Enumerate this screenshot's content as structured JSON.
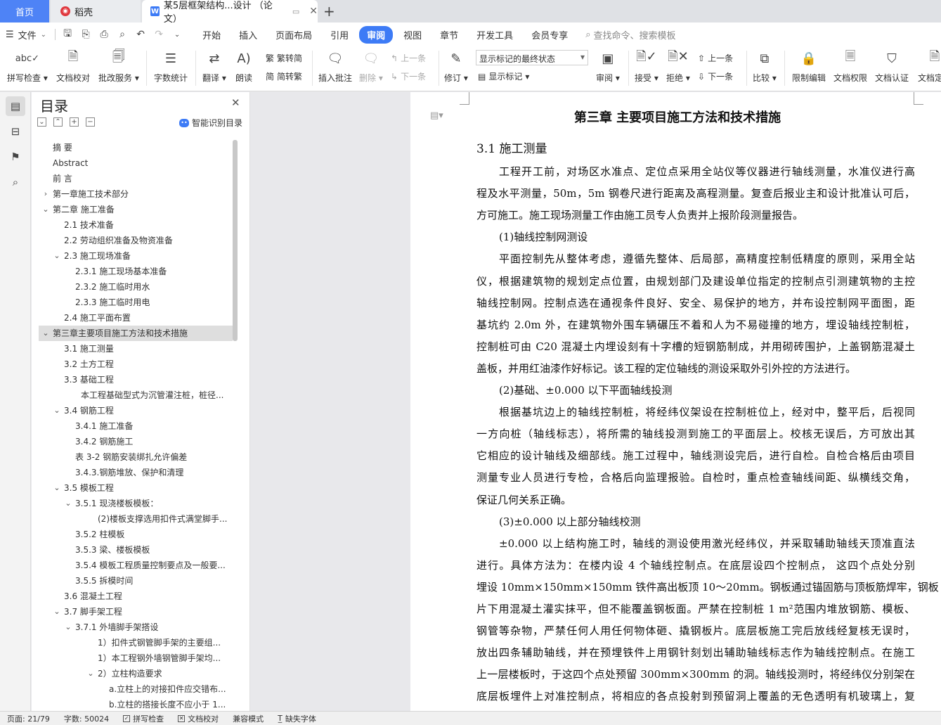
{
  "tabs": {
    "home": "首页",
    "daoke": "稻壳",
    "document": "某5层框架结构...设计 （论文）"
  },
  "menu": {
    "file": "文件",
    "tabs": [
      "开始",
      "插入",
      "页面布局",
      "引用",
      "审阅",
      "视图",
      "章节",
      "开发工具",
      "会员专享"
    ],
    "active_tab": "审阅",
    "search": "查找命令、搜索模板"
  },
  "ribbon": {
    "spell_check": "拼写检查",
    "doc_proof": "文档校对",
    "annotate_service": "批改服务",
    "word_count": "字数统计",
    "translate": "翻译",
    "read_aloud": "朗读",
    "trad_to_simp": "繁转简",
    "simp_to_trad": "简转繁",
    "insert_comment": "插入批注",
    "delete": "删除",
    "prev": "上一条",
    "next": "下一条",
    "track_changes": "修订",
    "markup_mode": "显示标记的最终状态",
    "show_markup": "显示标记",
    "review": "审阅",
    "accept": "接受",
    "reject": "拒绝",
    "prev_change": "上一条",
    "next_change": "下一条",
    "compare": "比较",
    "restrict_edit": "限制编辑",
    "doc_permission": "文档权限",
    "doc_certify": "文档认证",
    "doc_finalize": "文档定稿"
  },
  "toc": {
    "title": "目录",
    "smart_toc": "智能识别目录",
    "items": [
      {
        "text": "摘  要",
        "level": 0,
        "arrow": ""
      },
      {
        "text": "Abstract",
        "level": 0,
        "arrow": ""
      },
      {
        "text": "前  言",
        "level": 0,
        "arrow": ""
      },
      {
        "text": "第一章施工技术部分",
        "level": 0,
        "arrow": "›"
      },
      {
        "text": "第二章  施工准备",
        "level": 0,
        "arrow": "⌄"
      },
      {
        "text": "2.1 技术准备",
        "level": 1,
        "arrow": ""
      },
      {
        "text": "2.2 劳动组织准备及物资准备",
        "level": 1,
        "arrow": ""
      },
      {
        "text": "2.3 施工现场准备",
        "level": 1,
        "arrow": "⌄"
      },
      {
        "text": "2.3.1 施工现场基本准备",
        "level": 2,
        "arrow": ""
      },
      {
        "text": "2.3.2 施工临时用水",
        "level": 2,
        "arrow": ""
      },
      {
        "text": "2.3.3 施工临时用电",
        "level": 2,
        "arrow": ""
      },
      {
        "text": "2.4 施工平面布置",
        "level": 1,
        "arrow": ""
      },
      {
        "text": "第三章主要项目施工方法和技术措施",
        "level": 0,
        "arrow": "⌄",
        "selected": true
      },
      {
        "text": "3.1 施工测量",
        "level": 1,
        "arrow": ""
      },
      {
        "text": "3.2 土方工程",
        "level": 1,
        "arrow": ""
      },
      {
        "text": "3.3 基础工程",
        "level": 1,
        "arrow": ""
      },
      {
        "text": "本工程基础型式为沉管灌注桩，桩径...",
        "level": 2.5,
        "arrow": ""
      },
      {
        "text": "3.4 钢筋工程",
        "level": 1,
        "arrow": "⌄"
      },
      {
        "text": "3.4.1 施工准备",
        "level": 2,
        "arrow": ""
      },
      {
        "text": "3.4.2 钢筋施工",
        "level": 2,
        "arrow": ""
      },
      {
        "text": "表 3-2  钢筋安装绑扎允许偏差",
        "level": 2,
        "arrow": ""
      },
      {
        "text": "3.4.3.钢筋堆放、保护和清理",
        "level": 2,
        "arrow": ""
      },
      {
        "text": "3.5 模板工程",
        "level": 1,
        "arrow": "⌄"
      },
      {
        "text": "3.5.1 现浇楼板模板：",
        "level": 2,
        "arrow": "⌄"
      },
      {
        "text": "(2)楼板支撑选用扣件式满堂脚手...",
        "level": 3,
        "arrow": ""
      },
      {
        "text": "3.5.2 柱模板",
        "level": 2,
        "arrow": ""
      },
      {
        "text": "3.5.3 梁、楼板模板",
        "level": 2,
        "arrow": ""
      },
      {
        "text": "3.5.4 模板工程质量控制要点及一般要...",
        "level": 2,
        "arrow": ""
      },
      {
        "text": "3.5.5 拆模时间",
        "level": 2,
        "arrow": ""
      },
      {
        "text": "3.6 混凝土工程",
        "level": 1,
        "arrow": ""
      },
      {
        "text": "3.7 脚手架工程",
        "level": 1,
        "arrow": "⌄"
      },
      {
        "text": "3.7.1 外墙脚手架搭设",
        "level": 2,
        "arrow": "⌄"
      },
      {
        "text": "1）扣件式钢管脚手架的主要组...",
        "level": 3,
        "arrow": ""
      },
      {
        "text": "1）本工程钢外墙钢管脚手架均...",
        "level": 3,
        "arrow": ""
      },
      {
        "text": "2）立柱构造要求",
        "level": 3,
        "arrow": "⌄"
      },
      {
        "text": "a.立柱上的对接扣件应交错布...",
        "level": 4,
        "arrow": ""
      },
      {
        "text": "b.立柱的搭接长度不应小于 1...",
        "level": 4,
        "arrow": ""
      }
    ]
  },
  "document": {
    "chapter_title": "第三章  主要项目施工方法和技术措施",
    "section_title": "3.1 施工测量",
    "lines": [
      {
        "text": "工程开工前，对场区水准点、定位点采用全站仪等仪器进行轴线测量，水准仪进行高",
        "indent": true,
        "last": false
      },
      {
        "text": "程及水平测量，50m，5m 钢卷尺进行距离及高程测量。复查后报业主和设计批准认可后，",
        "indent": false,
        "last": false
      },
      {
        "text": "方可施工。施工现场测量工作由施工员专人负责并上报阶段测量报告。",
        "indent": false,
        "last": true
      },
      {
        "text": "(1)轴线控制网测设",
        "indent": true,
        "last": true
      },
      {
        "text": "平面控制先从整体考虑，遵循先整体、后局部，高精度控制低精度的原则，采用全站",
        "indent": true,
        "last": false
      },
      {
        "text": "仪，根据建筑物的规划定点位置，由规划部门及建设单位指定的控制点引测建筑物的主控",
        "indent": false,
        "last": false
      },
      {
        "text": "轴线控制网。控制点选在通视条件良好、安全、易保护的地方，并布设控制网平面图，距",
        "indent": false,
        "last": false
      },
      {
        "text": "基坑约 2.0m 外，在建筑物外围车辆碾压不着和人为不易碰撞的地方，埋设轴线控制桩，",
        "indent": false,
        "last": false
      },
      {
        "text": "控制桩可由 C20 混凝土内埋设刻有十字槽的短钢筋制成，并用砌砖围护，上盖钢筋混凝土",
        "indent": false,
        "last": false
      },
      {
        "text": "盖板，并用红油漆作好标记。该工程的定位轴线的测设采取外引外控的方法进行。",
        "indent": false,
        "last": true
      },
      {
        "text": "(2)基础、±0.000 以下平面轴线投测",
        "indent": true,
        "last": true
      },
      {
        "text": "根据基坑边上的轴线控制桩，将经纬仪架设在控制桩位上，经对中，整平后，后视同",
        "indent": true,
        "last": false
      },
      {
        "text": "一方向桩（轴线标志），将所需的轴线投测到施工的平面层上。校核无误后，方可放出其",
        "indent": false,
        "last": false
      },
      {
        "text": "它相应的设计轴线及细部线。施工过程中，轴线测设完后，进行自检。自检合格后由项目",
        "indent": false,
        "last": false
      },
      {
        "text": "测量专业人员进行专检，合格后向监理报验。自检时，重点检查轴线间距、纵横线交角，",
        "indent": false,
        "last": false
      },
      {
        "text": "保证几何关系正确。",
        "indent": false,
        "last": true
      },
      {
        "text": "(3)±0.000 以上部分轴线校测",
        "indent": true,
        "last": true
      },
      {
        "text": "±0.000 以上结构施工时，轴线的测设使用激光经纬仪，并采取辅助轴线天顶准直法",
        "indent": true,
        "last": false
      },
      {
        "text": "进行。具体方法为：在楼内设 4 个轴线控制点。在底层设四个控制点， 这四个点处分别",
        "indent": false,
        "last": false
      },
      {
        "text": "埋设 10mm×150mm×150mm 铁件高出板顶 10～20mm。钢板通过锚固筋与顶板筋焊牢，钢板",
        "indent": false,
        "last": false
      },
      {
        "text": "片下用混凝土灌实抹平，但不能覆盖钢板面。严禁在控制桩 1 m²范围内堆放钢筋、模板、",
        "indent": false,
        "last": false
      },
      {
        "text": "钢管等杂物，严禁任何人用任何物体砸、撬钢板片。底层板施工完后放线经复核无误时，",
        "indent": false,
        "last": false
      },
      {
        "text": "放出四条辅助轴线，并在预埋铁件上用钢针刻划出辅助轴线标志作为轴线控制点。在施工",
        "indent": false,
        "last": false
      },
      {
        "text": "上一层楼板时，于这四个点处预留 300mm×300mm 的洞。轴线投测时，将经纬仪分别架在",
        "indent": false,
        "last": false
      },
      {
        "text": "底层板埋件上对准控制点，将相应的各点投射到预留洞上覆盖的无色透明有机玻璃上，复",
        "indent": false,
        "last": false
      }
    ]
  },
  "status": {
    "page": "页面: 21/79",
    "words": "字数: 50024",
    "spell_check": "拼写检查",
    "doc_proof": "文档校对",
    "compat_mode": "兼容模式",
    "missing_font": "缺失字体"
  },
  "colors": {
    "accent": "#3d7bf6",
    "selected_toc": "#dedede"
  }
}
